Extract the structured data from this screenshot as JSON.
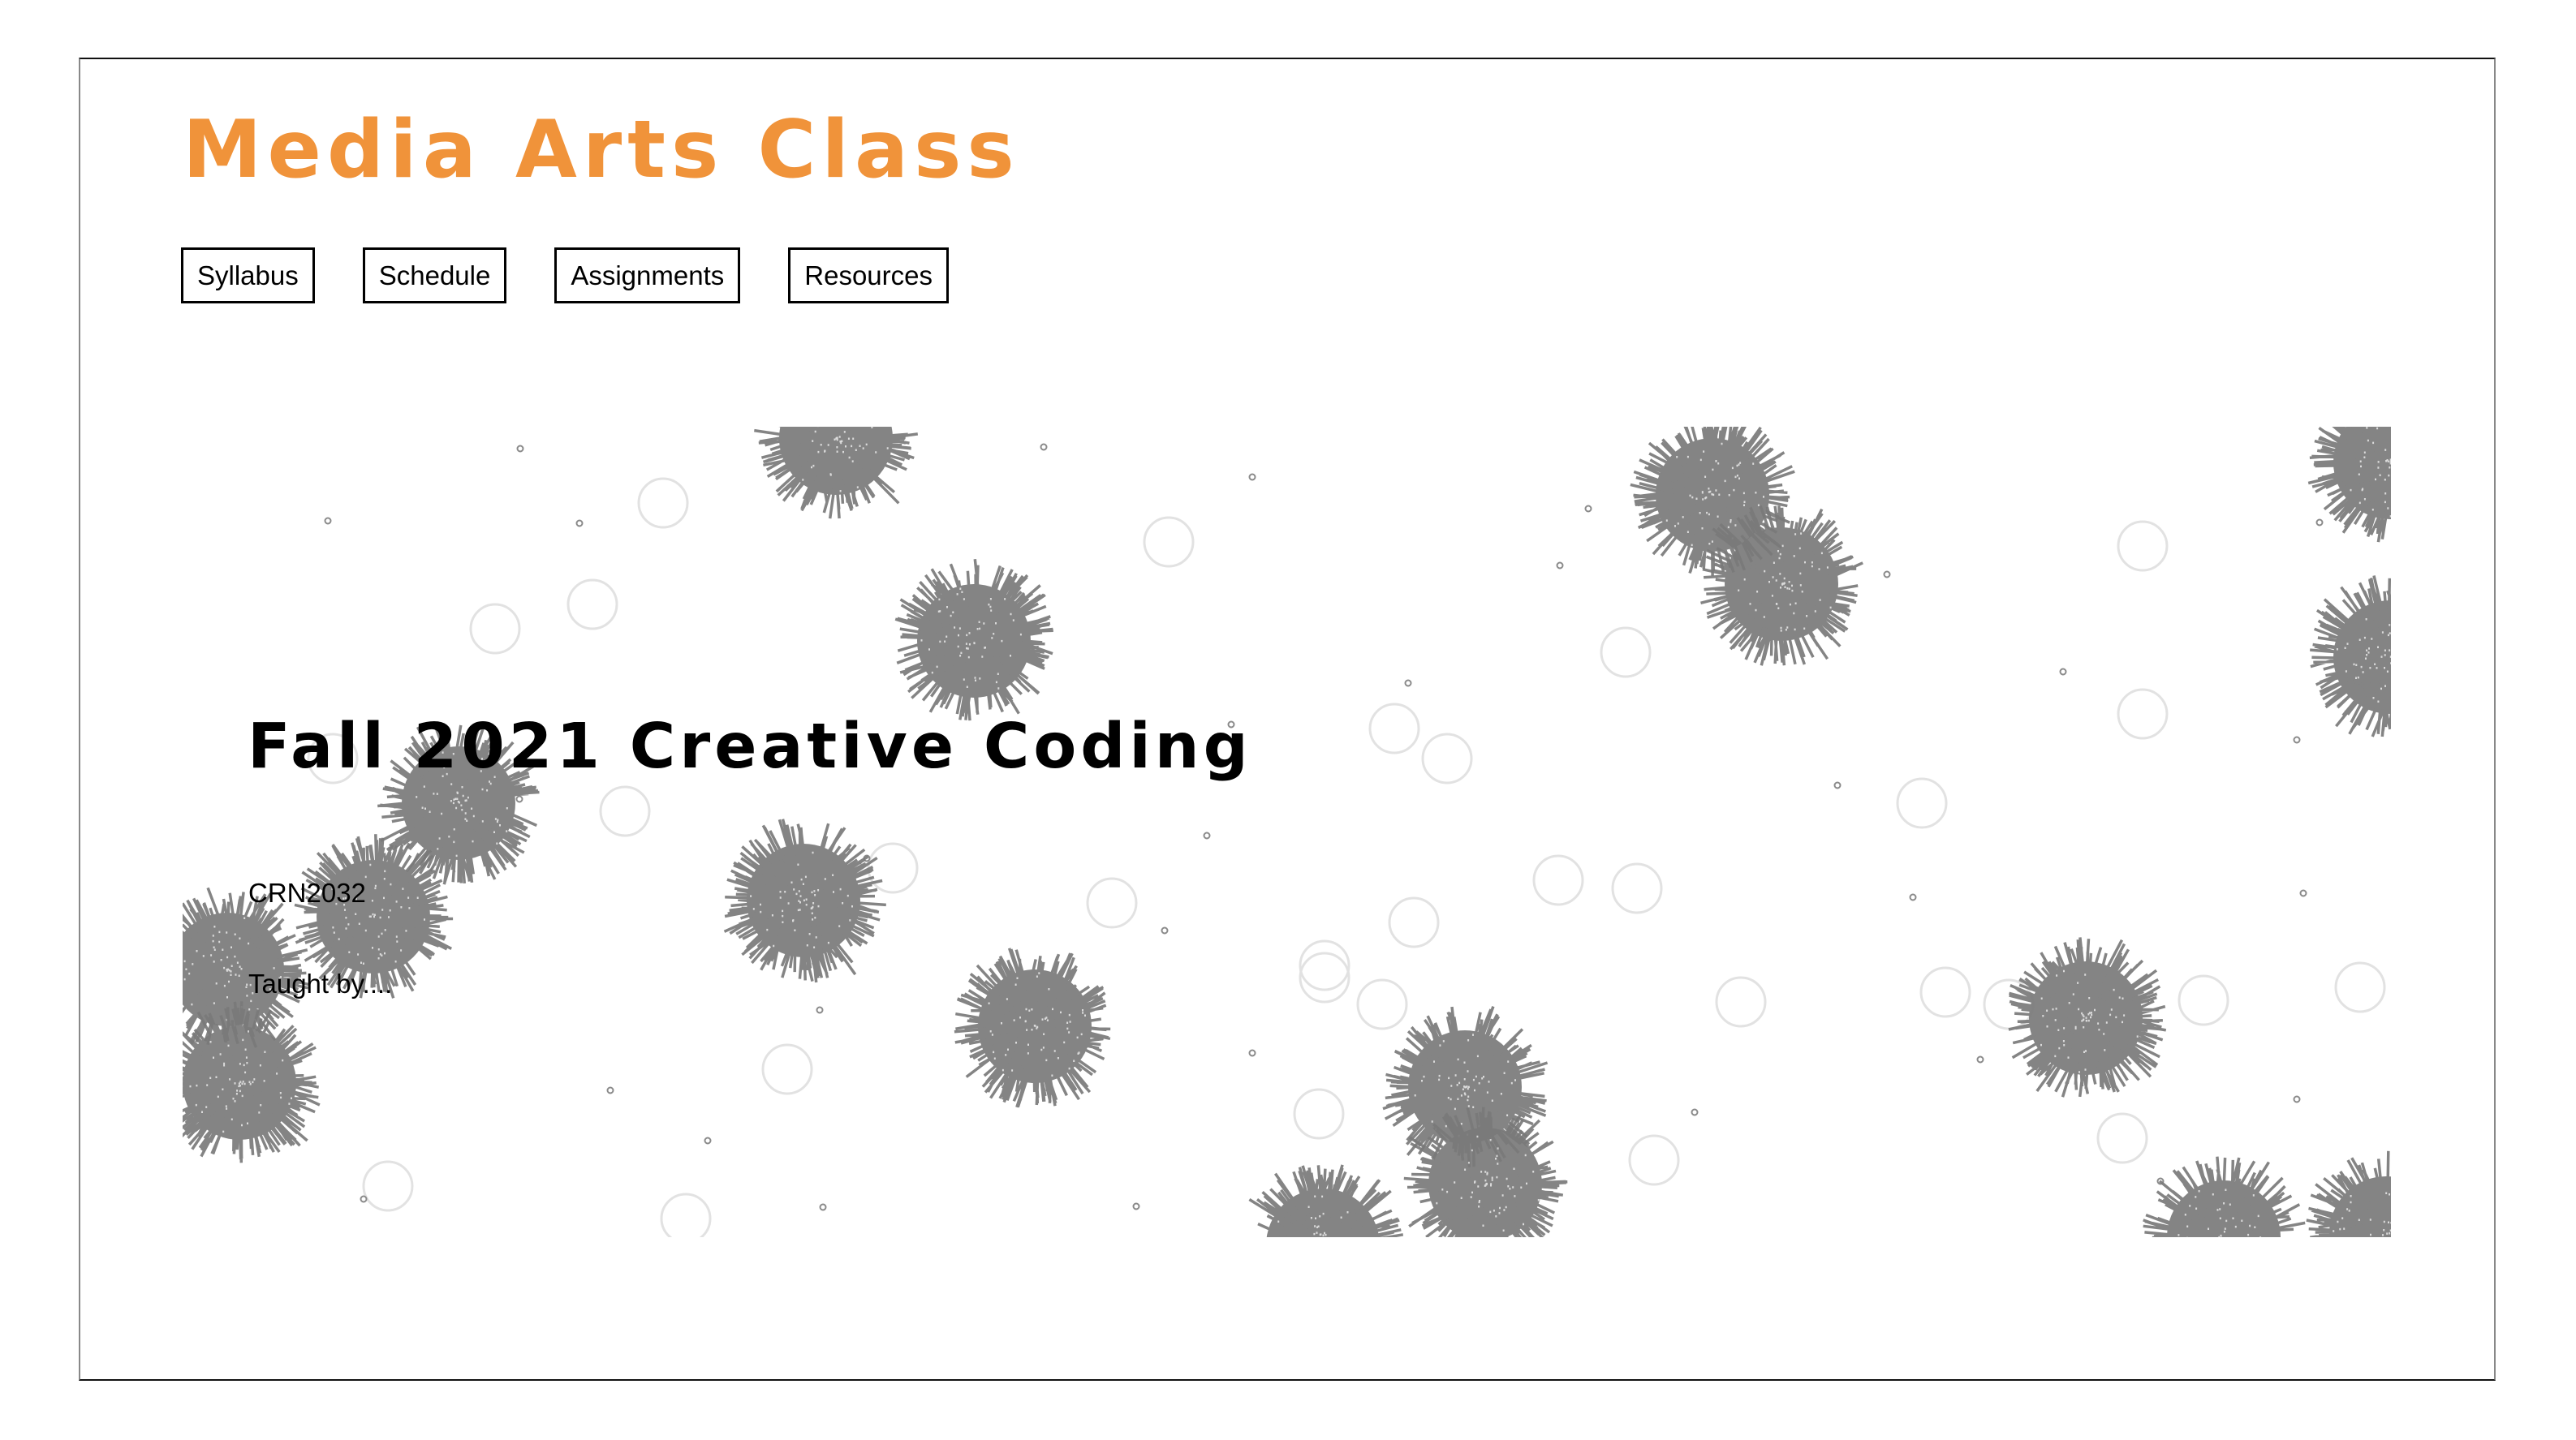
{
  "site": {
    "title": "Media Arts Class",
    "accent_color": "#F0933A"
  },
  "nav": {
    "items": [
      {
        "label": "Syllabus"
      },
      {
        "label": "Schedule"
      },
      {
        "label": "Assignments"
      },
      {
        "label": "Resources"
      }
    ]
  },
  "hero": {
    "title": "Fall 2021 Creative Coding",
    "crn": "CRN2032",
    "taught_by": "Taught by...."
  },
  "sketch": {
    "description": "animated generative canvas with spiky gray balls, outlined bubbles and small dots",
    "colors": {
      "spiky_ball": "#7a7a7a",
      "bubble_stroke": "#e2e2e2",
      "dot_stroke": "#8a8a8a"
    }
  }
}
